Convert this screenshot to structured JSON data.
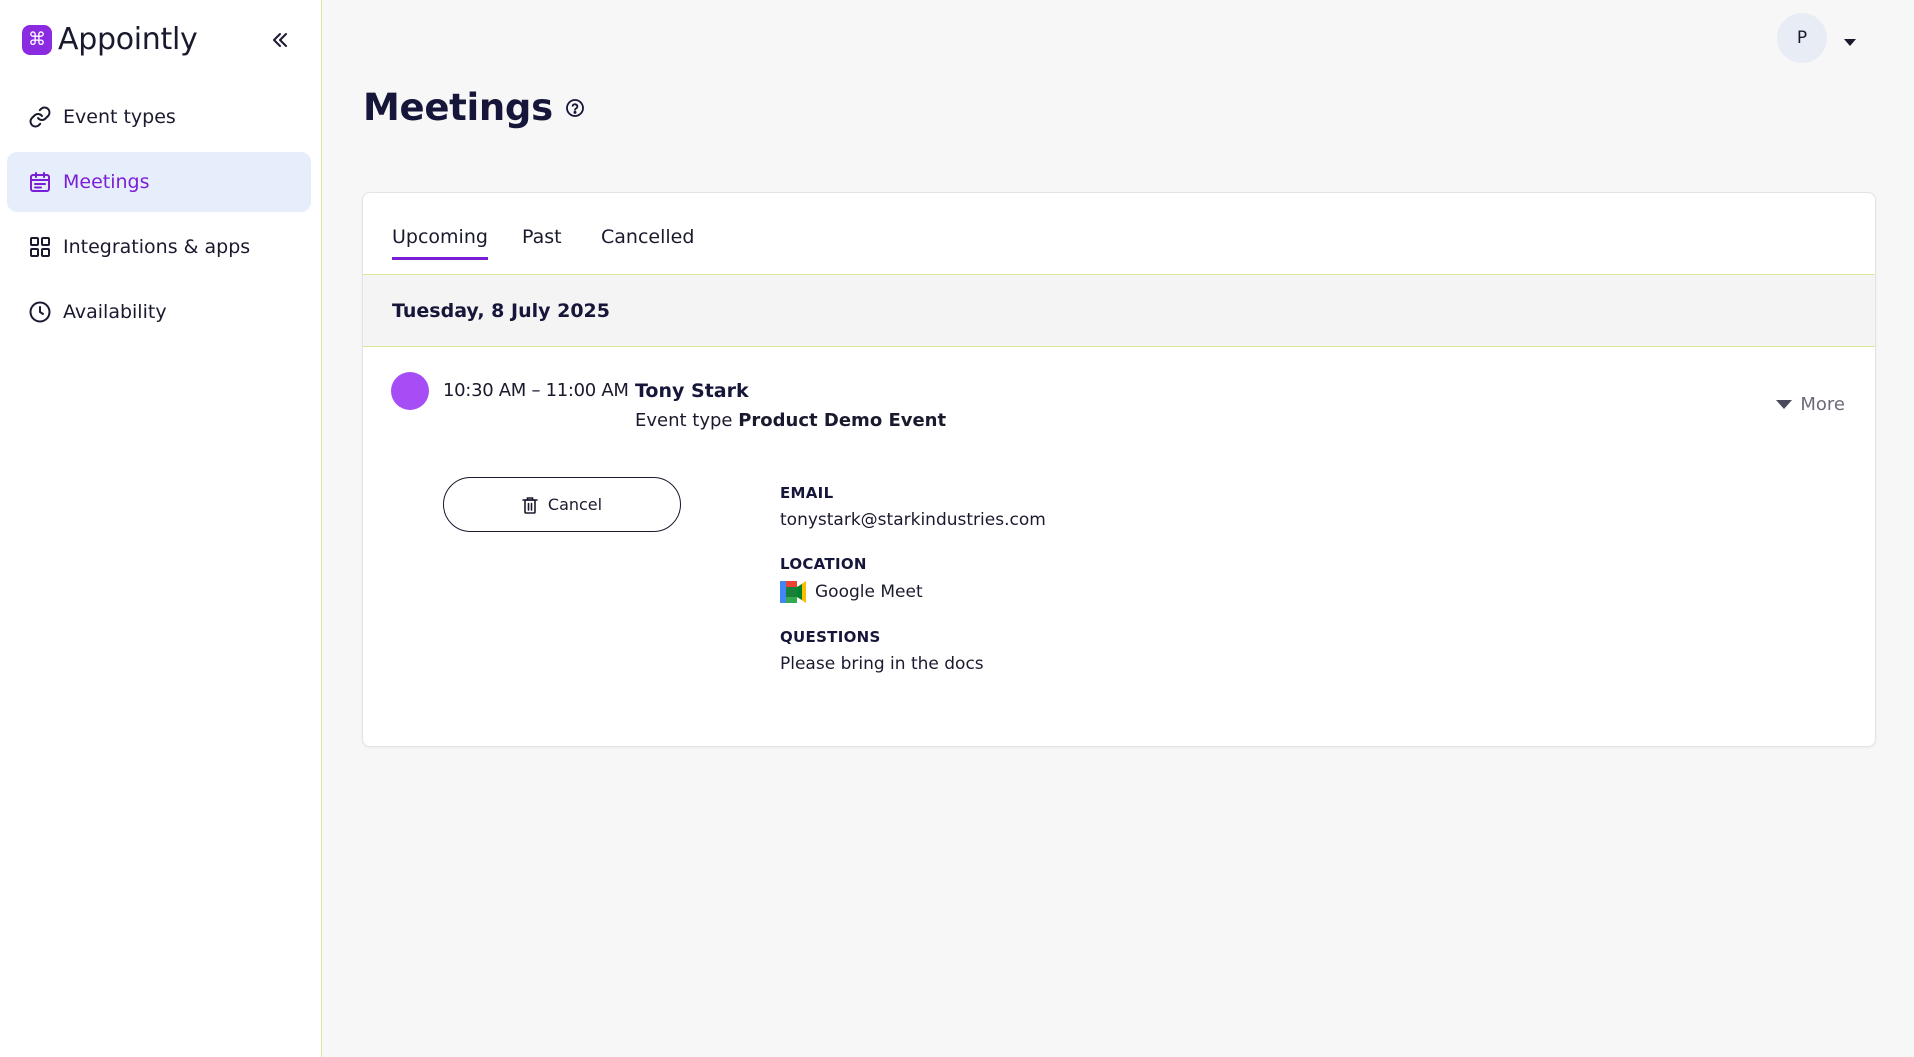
{
  "brand": {
    "name": "Appointly",
    "logo_glyph": "⌘",
    "accent": "#8a2be2"
  },
  "sidebar": {
    "items": [
      {
        "label": "Event types",
        "icon": "link-icon",
        "active": false
      },
      {
        "label": "Meetings",
        "icon": "calendar-icon",
        "active": true
      },
      {
        "label": "Integrations & apps",
        "icon": "grid-icon",
        "active": false
      },
      {
        "label": "Availability",
        "icon": "clock-icon",
        "active": false
      }
    ]
  },
  "user": {
    "avatar_initial": "P"
  },
  "page": {
    "title": "Meetings"
  },
  "tabs": [
    {
      "label": "Upcoming",
      "active": true
    },
    {
      "label": "Past",
      "active": false
    },
    {
      "label": "Cancelled",
      "active": false
    }
  ],
  "date_header": "Tuesday, 8 July 2025",
  "meeting": {
    "time": "10:30 AM – 11:00 AM",
    "invitee": "Tony Stark",
    "event_type_prefix": "Event type",
    "event_type": "Product Demo Event",
    "more_label": "More",
    "cancel_label": "Cancel",
    "dot_color": "#a64df5",
    "email_label": "EMAIL",
    "email": "tonystark@starkindustries.com",
    "location_label": "LOCATION",
    "location": "Google Meet",
    "location_icon": "google-meet-icon",
    "questions_label": "QUESTIONS",
    "questions": "Please bring in the docs"
  },
  "colors": {
    "active_nav_bg": "#e6edfb",
    "active_text": "#7b1fd6",
    "divider": "#d9e89a"
  }
}
